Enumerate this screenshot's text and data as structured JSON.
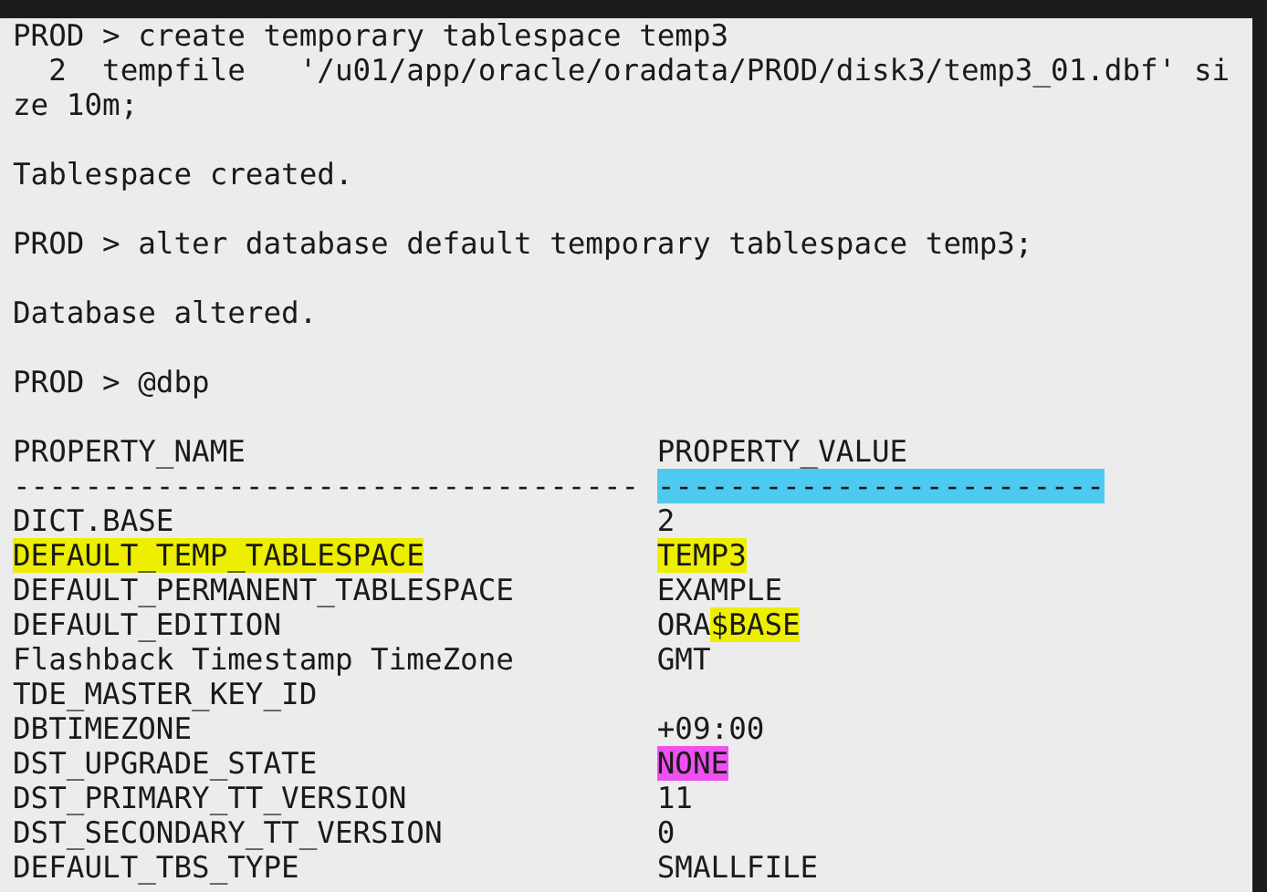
{
  "terminal": {
    "blocks": [
      [
        "PROD > create temporary tablespace temp3",
        "  2  tempfile   '/u01/app/oracle/oradata/PROD/disk3/temp3_01.dbf' si",
        "ze 10m;"
      ],
      [
        "Tablespace created."
      ],
      [
        "PROD > alter database default temporary tablespace temp3;"
      ],
      [
        "Database altered."
      ],
      [
        "PROD > @dbp"
      ]
    ],
    "table": {
      "columns": [
        "PROPERTY_NAME",
        "PROPERTY_VALUE"
      ],
      "separator": [
        {
          "text": "-----------------------------------"
        },
        {
          "text": "-------------------------",
          "color": "#4ec9ef"
        }
      ],
      "rows": [
        {
          "name": [
            {
              "text": "DICT.BASE"
            }
          ],
          "value": [
            {
              "text": "2"
            }
          ]
        },
        {
          "name": [
            {
              "text": "DEFAULT_TEMP_TABLESPACE",
              "color": "#eeee00"
            }
          ],
          "value": [
            {
              "text": "TEMP3",
              "color": "#eeee00"
            }
          ]
        },
        {
          "name": [
            {
              "text": "DEFAULT_PERMANENT_TABLESPACE"
            }
          ],
          "value": [
            {
              "text": "EXAMPLE"
            }
          ]
        },
        {
          "name": [
            {
              "text": "DEFAULT_EDITION"
            }
          ],
          "value": [
            {
              "text": "ORA"
            },
            {
              "text": "$BASE",
              "color": "#eeee00"
            }
          ]
        },
        {
          "name": [
            {
              "text": "Flashback Timestamp TimeZone"
            }
          ],
          "value": [
            {
              "text": "GMT"
            }
          ]
        },
        {
          "name": [
            {
              "text": "TDE_MASTER_KEY_ID"
            }
          ],
          "value": []
        },
        {
          "name": [
            {
              "text": "DBTIMEZONE"
            }
          ],
          "value": [
            {
              "text": "+09:00"
            }
          ]
        },
        {
          "name": [
            {
              "text": "DST_UPGRADE_STATE"
            }
          ],
          "value": [
            {
              "text": "NONE",
              "color": "#f050f0"
            }
          ]
        },
        {
          "name": [
            {
              "text": "DST_PRIMARY_TT_VERSION"
            }
          ],
          "value": [
            {
              "text": "11"
            }
          ]
        },
        {
          "name": [
            {
              "text": "DST_SECONDARY_TT_VERSION"
            }
          ],
          "value": [
            {
              "text": "0"
            }
          ]
        },
        {
          "name": [
            {
              "text": "DEFAULT_TBS_TYPE"
            }
          ],
          "value": [
            {
              "text": "SMALLFILE"
            }
          ]
        }
      ]
    }
  }
}
